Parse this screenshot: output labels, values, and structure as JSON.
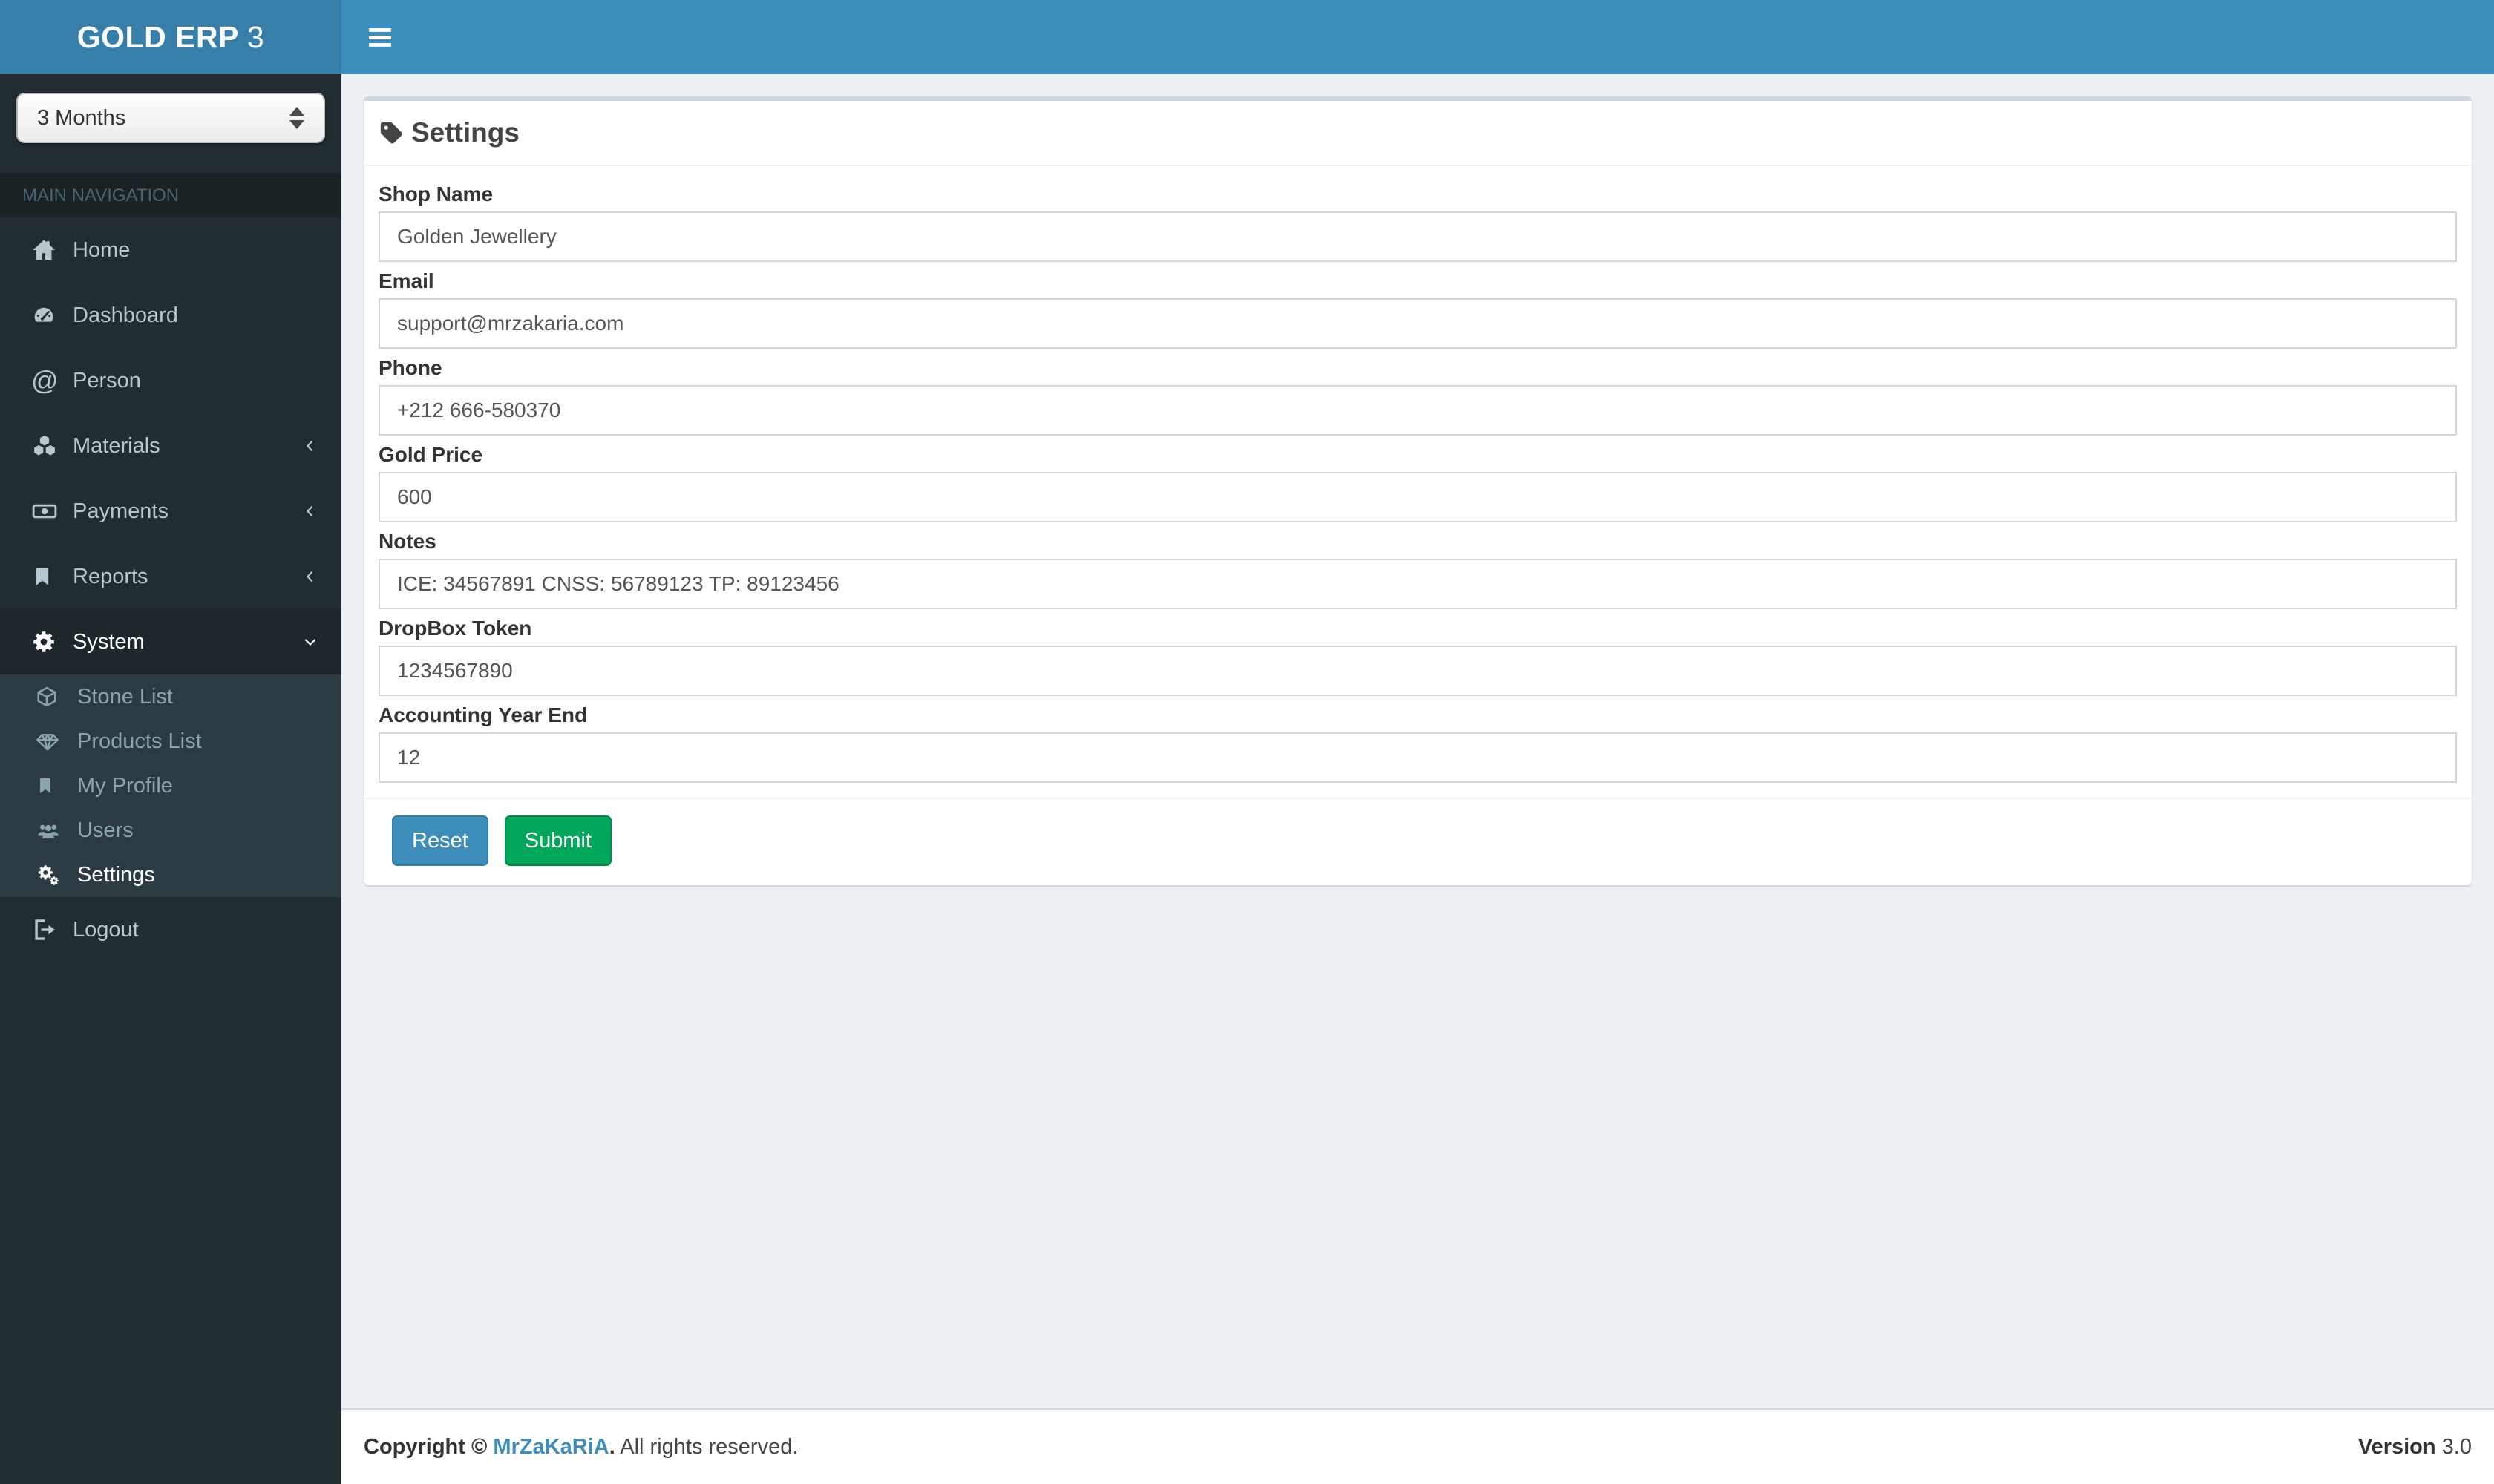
{
  "brand": {
    "bold": "GOLD ERP",
    "thin": "3"
  },
  "sidebar": {
    "period_select": {
      "value": "3 Months"
    },
    "section_header": "MAIN NAVIGATION",
    "items": [
      {
        "label": "Home",
        "icon": "home-icon"
      },
      {
        "label": "Dashboard",
        "icon": "dashboard-icon"
      },
      {
        "label": "Person",
        "icon": "at-icon"
      },
      {
        "label": "Materials",
        "icon": "cubes-icon",
        "chevron": "left"
      },
      {
        "label": "Payments",
        "icon": "money-icon",
        "chevron": "left"
      },
      {
        "label": "Reports",
        "icon": "bookmark-icon",
        "chevron": "left"
      },
      {
        "label": "System",
        "icon": "gear-icon",
        "chevron": "down",
        "active": true
      }
    ],
    "system_submenu": [
      {
        "label": "Stone List",
        "icon": "cube-icon"
      },
      {
        "label": "Products List",
        "icon": "diamond-icon"
      },
      {
        "label": "My Profile",
        "icon": "bookmark-icon"
      },
      {
        "label": "Users",
        "icon": "users-icon"
      },
      {
        "label": "Settings",
        "icon": "gears-icon",
        "active": true
      }
    ],
    "logout": {
      "label": "Logout",
      "icon": "sign-out-icon"
    }
  },
  "main": {
    "card_title": "Settings",
    "form": {
      "fields": [
        {
          "label": "Shop Name",
          "value": "Golden Jewellery"
        },
        {
          "label": "Email",
          "value": "support@mrzakaria.com"
        },
        {
          "label": "Phone",
          "value": "+212 666-580370"
        },
        {
          "label": "Gold Price",
          "value": "600"
        },
        {
          "label": "Notes",
          "value": "ICE: 34567891 CNSS: 56789123 TP: 89123456"
        },
        {
          "label": "DropBox Token",
          "value": "1234567890"
        },
        {
          "label": "Accounting Year End",
          "value": "12"
        }
      ],
      "buttons": {
        "reset": "Reset",
        "submit": "Submit"
      }
    }
  },
  "footer": {
    "copyright_prefix": "Copyright ©",
    "author": "MrZaKaRiA",
    "author_suffix": ".",
    "rights": "All rights reserved.",
    "version_label": "Version",
    "version_number": "3.0"
  },
  "colors": {
    "navbar": "#3c8dbc",
    "logo_bg": "#367fa9",
    "sidebar_bg": "#222d32",
    "sidebar_active_bg": "#1e282c",
    "submenu_bg": "#2c3b41",
    "sidebar_text": "#b8c7ce",
    "submenu_text": "#8aa4af",
    "content_bg": "#ecf0f5",
    "box_top_border": "#d2d6de",
    "reset_button": "#3c8dbc",
    "submit_button": "#00a65a",
    "link": "#3c8dbc"
  }
}
